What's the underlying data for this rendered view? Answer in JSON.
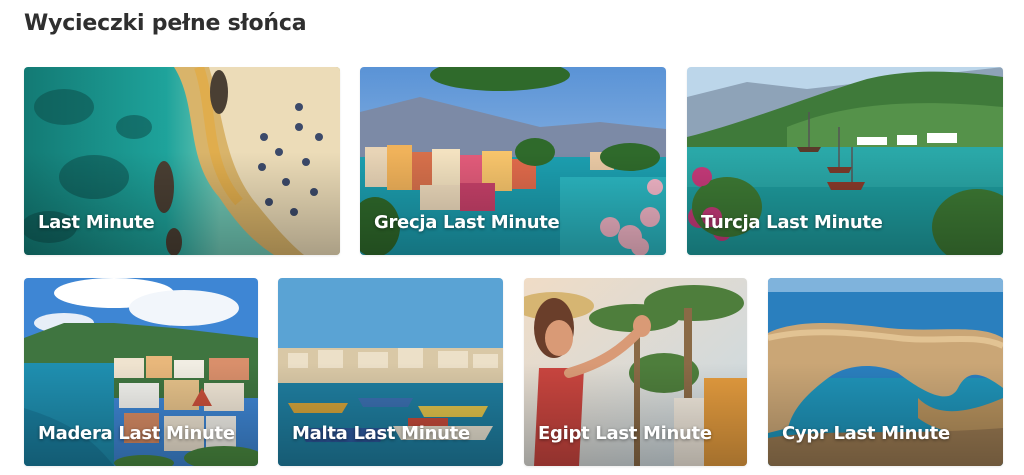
{
  "section": {
    "title": "Wycieczki pełne słońca"
  },
  "cards": [
    {
      "label": "Last Minute",
      "image": "aerial-beach-umbrellas"
    },
    {
      "label": "Grecja Last Minute",
      "image": "greek-harbour-village-flowers"
    },
    {
      "label": "Turcja Last Minute",
      "image": "turkish-bay-boats-hills"
    },
    {
      "label": "Madera Last Minute",
      "image": "madeira-coastal-town"
    },
    {
      "label": "Malta Last Minute",
      "image": "malta-harbour-fishing-boats"
    },
    {
      "label": "Egipt Last Minute",
      "image": "woman-palm-trees-resort"
    },
    {
      "label": "Cypr Last Minute",
      "image": "cyprus-rock-arch-sea"
    }
  ]
}
